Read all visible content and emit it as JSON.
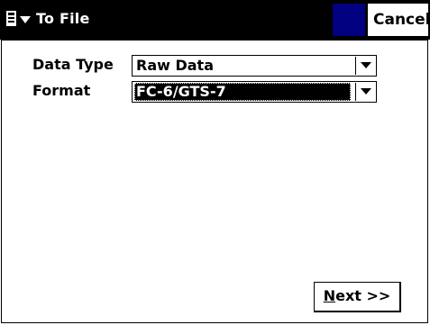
{
  "header": {
    "title": "To File",
    "cancel_label": "Cancel",
    "menu_icon": "menu-icon",
    "dropdown_icon": "chevron-down-icon",
    "accent_color": "#000080"
  },
  "form": {
    "data_type": {
      "label": "Data Type",
      "value": "Raw Data"
    },
    "format": {
      "label": "Format",
      "value": "FC-6/GTS-7"
    }
  },
  "footer": {
    "next_mnemonic": "N",
    "next_rest": "ext >>"
  }
}
